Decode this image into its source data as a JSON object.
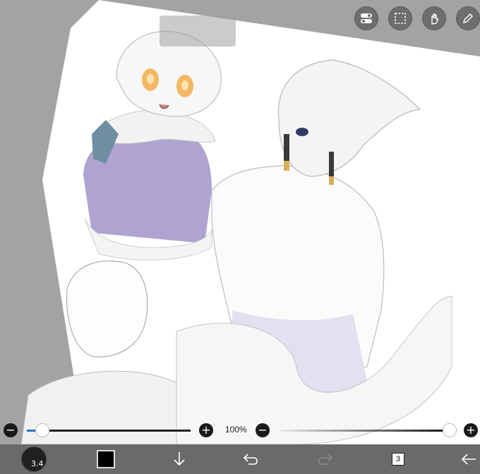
{
  "colors": {
    "background": "#a3a3a3",
    "paper": "#ffffff",
    "toolbar": "#6e6e6e",
    "bottom_bar": "#6a6a6a",
    "slider_accent": "#2f6fbf",
    "primary_color": "#000000",
    "purple_coat": "#ab9fcf",
    "blue_sleeve": "#6f8ea1"
  },
  "toolbar": {
    "icons": [
      "toggle-icon",
      "selection-icon",
      "hand-icon",
      "pen-icon"
    ]
  },
  "sliders": {
    "brush_size": {
      "value_fraction": 0.04,
      "minus": "−",
      "plus": "+"
    },
    "zoom": {
      "label": "100%"
    },
    "opacity": {
      "value_fraction": 1.0,
      "minus": "−",
      "plus": "+"
    }
  },
  "bottom_bar": {
    "brush_size": "3.4",
    "layer_count": "3",
    "icons": [
      "brush-preview",
      "color-swatch",
      "download-icon",
      "undo-icon",
      "redo-icon",
      "layers-icon",
      "back-icon"
    ]
  }
}
